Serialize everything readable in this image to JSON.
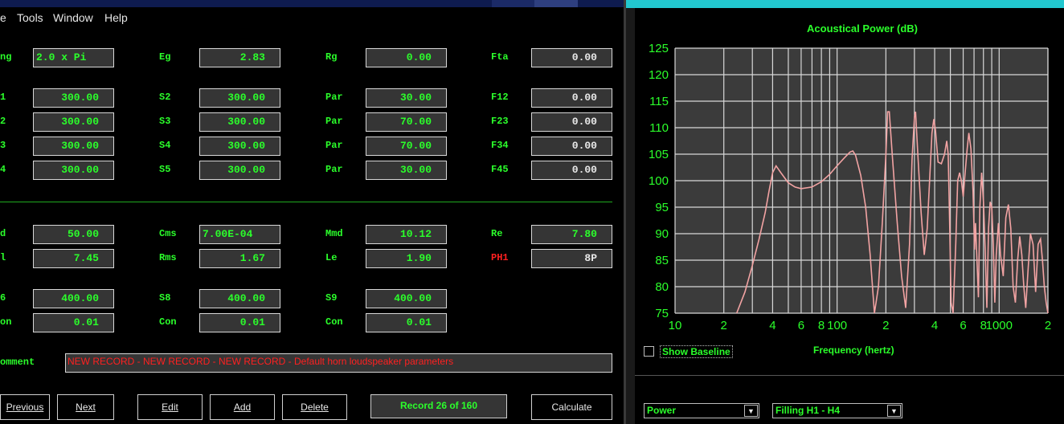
{
  "menu": [
    "e",
    "Tools",
    "Window",
    "Help"
  ],
  "rows": [
    {
      "cells": [
        [
          "ng",
          "2.0 x Pi"
        ],
        [
          "Eg",
          "2.83"
        ],
        [
          "Rg",
          "0.00"
        ],
        [
          "Fta",
          "0.00"
        ]
      ]
    },
    {
      "cells": [
        [
          "1",
          "300.00"
        ],
        [
          "S2",
          "300.00"
        ],
        [
          "Par",
          "30.00"
        ],
        [
          "F12",
          "0.00"
        ]
      ]
    },
    {
      "cells": [
        [
          "2",
          "300.00"
        ],
        [
          "S3",
          "300.00"
        ],
        [
          "Par",
          "70.00"
        ],
        [
          "F23",
          "0.00"
        ]
      ]
    },
    {
      "cells": [
        [
          "3",
          "300.00"
        ],
        [
          "S4",
          "300.00"
        ],
        [
          "Par",
          "70.00"
        ],
        [
          "F34",
          "0.00"
        ]
      ]
    },
    {
      "cells": [
        [
          "4",
          "300.00"
        ],
        [
          "S5",
          "300.00"
        ],
        [
          "Par",
          "30.00"
        ],
        [
          "F45",
          "0.00"
        ]
      ]
    },
    {
      "cells": [
        [
          "d",
          "50.00"
        ],
        [
          "Cms",
          "7.00E-04"
        ],
        [
          "Mmd",
          "10.12"
        ],
        [
          "Re",
          "7.80"
        ]
      ]
    },
    {
      "cells": [
        [
          "l",
          "7.45"
        ],
        [
          "Rms",
          "1.67"
        ],
        [
          "Le",
          "1.90"
        ],
        [
          "PH1",
          "8P"
        ]
      ]
    },
    {
      "cells": [
        [
          "6",
          "400.00"
        ],
        [
          "S8",
          "400.00"
        ],
        [
          "S9",
          "400.00"
        ]
      ]
    },
    {
      "cells": [
        [
          "on",
          "0.01"
        ],
        [
          "Con",
          "0.01"
        ],
        [
          "Con",
          "0.01"
        ]
      ]
    }
  ],
  "comment": {
    "label": "omment",
    "value": "NEW RECORD - NEW RECORD - NEW RECORD - Default horn loudspeaker parameters"
  },
  "buttons": {
    "previous": "Previous",
    "next": "Next",
    "edit": "Edit",
    "add": "Add",
    "delete": "Delete",
    "calculate": "Calculate"
  },
  "record": "Record 26 of 160",
  "right": {
    "show_baseline": "Show Baseline",
    "combo_power": "Power",
    "combo_filling": "Filling H1 - H4"
  },
  "colors": {
    "grid": "#d8d8d8",
    "plot_bg": "#3b3b3b",
    "curve": "#f2a3a3",
    "label": "#2bff2b"
  },
  "chart_data": {
    "type": "line",
    "title": "Acoustical Power (dB)",
    "xlabel": "Frequency (hertz)",
    "ylabel": "",
    "x_scale": "log",
    "xlim": [
      10,
      2000
    ],
    "ylim": [
      75,
      125
    ],
    "grid": true,
    "x_ticks": [
      {
        "v": 10,
        "label": "10"
      },
      {
        "v": 20,
        "label": "2"
      },
      {
        "v": 40,
        "label": "4"
      },
      {
        "v": 60,
        "label": "6"
      },
      {
        "v": 80,
        "label": "8"
      },
      {
        "v": 100,
        "label": "100"
      },
      {
        "v": 200,
        "label": "2"
      },
      {
        "v": 400,
        "label": "4"
      },
      {
        "v": 600,
        "label": "6"
      },
      {
        "v": 800,
        "label": "8"
      },
      {
        "v": 1000,
        "label": "1000"
      },
      {
        "v": 2000,
        "label": "2"
      }
    ],
    "y_ticks": [
      75,
      80,
      85,
      90,
      95,
      100,
      105,
      110,
      115,
      120,
      125
    ],
    "series": [
      {
        "points": [
          [
            24,
            75
          ],
          [
            27,
            79
          ],
          [
            30,
            84
          ],
          [
            33,
            89
          ],
          [
            36,
            94
          ],
          [
            38,
            98
          ],
          [
            40,
            101.5
          ],
          [
            42,
            102.8
          ],
          [
            45,
            101.5
          ],
          [
            50,
            99.6
          ],
          [
            55,
            98.8
          ],
          [
            60,
            98.5
          ],
          [
            70,
            98.8
          ],
          [
            80,
            99.8
          ],
          [
            90,
            101.2
          ],
          [
            100,
            102.8
          ],
          [
            110,
            104.2
          ],
          [
            120,
            105.4
          ],
          [
            125,
            105.6
          ],
          [
            130,
            104.8
          ],
          [
            140,
            101
          ],
          [
            150,
            95
          ],
          [
            160,
            86
          ],
          [
            170,
            75
          ],
          [
            180,
            80
          ],
          [
            190,
            92
          ],
          [
            200,
            105
          ],
          [
            205,
            113
          ],
          [
            210,
            113
          ],
          [
            220,
            104
          ],
          [
            235,
            92
          ],
          [
            250,
            82
          ],
          [
            265,
            76
          ],
          [
            280,
            88
          ],
          [
            290,
            104
          ],
          [
            300,
            112
          ],
          [
            305,
            113
          ],
          [
            315,
            105
          ],
          [
            330,
            94
          ],
          [
            345,
            86
          ],
          [
            360,
            91
          ],
          [
            375,
            102
          ],
          [
            385,
            109
          ],
          [
            395,
            111.6
          ],
          [
            405,
            109.5
          ],
          [
            420,
            103.5
          ],
          [
            440,
            103.2
          ],
          [
            460,
            105
          ],
          [
            475,
            107.5
          ],
          [
            485,
            105
          ],
          [
            495,
            92
          ],
          [
            505,
            77
          ],
          [
            520,
            75
          ],
          [
            540,
            88
          ],
          [
            555,
            100
          ],
          [
            570,
            101.5
          ],
          [
            585,
            100
          ],
          [
            600,
            97
          ],
          [
            615,
            101
          ],
          [
            635,
            106
          ],
          [
            650,
            109
          ],
          [
            670,
            106
          ],
          [
            690,
            98
          ],
          [
            705,
            87
          ],
          [
            715,
            92
          ],
          [
            730,
            85
          ],
          [
            745,
            78
          ],
          [
            760,
            95
          ],
          [
            780,
            101.5
          ],
          [
            800,
            96
          ],
          [
            820,
            87
          ],
          [
            840,
            76
          ],
          [
            860,
            91
          ],
          [
            880,
            96
          ],
          [
            900,
            95
          ],
          [
            920,
            88
          ],
          [
            940,
            77
          ],
          [
            960,
            86
          ],
          [
            990,
            92
          ],
          [
            1020,
            86
          ],
          [
            1060,
            82
          ],
          [
            1100,
            93
          ],
          [
            1140,
            95.5
          ],
          [
            1180,
            91
          ],
          [
            1220,
            80
          ],
          [
            1260,
            77
          ],
          [
            1300,
            85
          ],
          [
            1340,
            89.5
          ],
          [
            1380,
            86
          ],
          [
            1420,
            80
          ],
          [
            1460,
            76
          ],
          [
            1500,
            82
          ],
          [
            1560,
            90
          ],
          [
            1620,
            88
          ],
          [
            1680,
            79
          ],
          [
            1740,
            88
          ],
          [
            1800,
            89
          ],
          [
            1850,
            85
          ],
          [
            1900,
            80
          ],
          [
            1950,
            77
          ],
          [
            2000,
            75
          ]
        ]
      }
    ]
  }
}
